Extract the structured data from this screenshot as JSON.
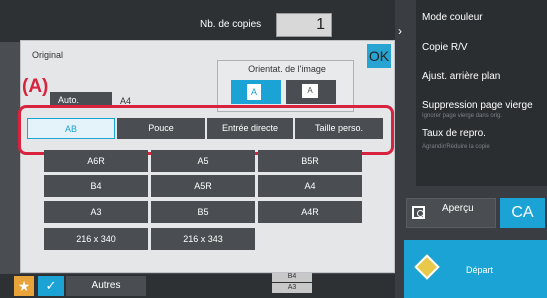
{
  "header": {
    "copies_label": "Nb. de copies",
    "copies_value": "1"
  },
  "right_menu": {
    "items": [
      "Mode couleur",
      "Copie R/V",
      "Ajust. arrière plan",
      "Suppression page vierge",
      "Taux de repro."
    ],
    "sub_items": [
      "Ignorer page vierge dans orig.",
      "Agrandir/Réduire la copie"
    ]
  },
  "actions": {
    "apercu_label": "Aperçu",
    "ca_label": "CA",
    "depart_label": "Départ",
    "autres_label": "Autres"
  },
  "trays": {
    "b4": "B4",
    "a3": "A3"
  },
  "dialog": {
    "title": "Original",
    "ok_label": "OK",
    "auto_label": "Auto.",
    "auto_value": "A4",
    "orientation_label": "Orientat. de l'image",
    "orientation_portrait_glyph": "A",
    "orientation_landscape_glyph": "A",
    "callout": "(A)",
    "tabs": [
      "AB",
      "Pouce",
      "Entrée directe",
      "Taille perso."
    ],
    "active_tab": "AB",
    "paper_sizes": [
      "A6R",
      "A5",
      "B5R",
      "B4",
      "A5R",
      "A4",
      "A3",
      "B5",
      "A4R",
      "216 x 340",
      "216 x 343"
    ]
  },
  "colors": {
    "accent_blue": "#1aa3d4",
    "highlight_red": "#d8233f",
    "depart_diamond": "#e8c94a",
    "star_orange": "#e8a33a"
  }
}
